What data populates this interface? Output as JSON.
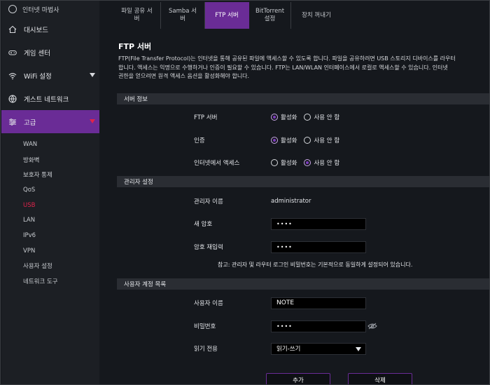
{
  "sidebar": {
    "top_label": "인터넷 마법사",
    "items": [
      {
        "label": "대시보드"
      },
      {
        "label": "게임 센터"
      },
      {
        "label": "WiFi 설정"
      },
      {
        "label": "게스트 네트워크"
      },
      {
        "label": "고급"
      }
    ],
    "sub_items": [
      {
        "label": "WAN"
      },
      {
        "label": "방화벽"
      },
      {
        "label": "보호자 통제"
      },
      {
        "label": "QoS"
      },
      {
        "label": "USB"
      },
      {
        "label": "LAN"
      },
      {
        "label": "IPv6"
      },
      {
        "label": "VPN"
      },
      {
        "label": "사용자 설정"
      },
      {
        "label": "네트워크 도구"
      }
    ]
  },
  "tabs": [
    {
      "label": "파일 공유 서버"
    },
    {
      "label": "Samba 서버"
    },
    {
      "label": "FTP 서버"
    },
    {
      "label": "BitTorrent 설정"
    },
    {
      "label": "장치 꺼내기"
    }
  ],
  "page": {
    "title": "FTP 서버",
    "desc_line1": "FTP(File Transfer Protocol)는 인터넷을 통해 공유된 파일에 액세스할 수 있도록 합니다. 파일을 공유하려면 USB 스토리지 디바이스를 라우터",
    "desc_line2": "합니다. 액세스는 익명으로 수행하거나 인증이 필요할 수 있습니다. FTP는 LAN/WLAN 인터페이스에서 로컬로 액세스할 수 있습니다. 인터넷",
    "desc_line3": "권한을 얻으려면 원격 액세스 옵션을 활성화해야 합니다."
  },
  "server_info": {
    "section_title": "서버 정보",
    "ftp_server_label": "FTP 서버",
    "auth_label": "인증",
    "internet_access_label": "인터넷에서 액세스",
    "enable_label": "활성화",
    "disable_label": "사용 안 함"
  },
  "admin": {
    "section_title": "관리자 설정",
    "username_label": "관리자 이름",
    "username_value": "administrator",
    "new_password_label": "새 암호",
    "new_password_value": "••••",
    "confirm_password_label": "암호 재입력",
    "confirm_password_value": "••••",
    "note": "참고: 관리자 및 라우터 로그인 비밀번호는 기본적으로 동일하게 설정되어 있습니다."
  },
  "users": {
    "section_title": "사용자 계정 목록",
    "username_label": "사용자 이름",
    "username_value": "NOTE",
    "password_label": "비밀번호",
    "password_value": "••••",
    "readonly_label": "읽기 전용",
    "readonly_value": "읽기-쓰기"
  },
  "buttons": {
    "add": "추가",
    "delete": "삭제"
  },
  "colors": {
    "accent": "#6a2c96",
    "active_text": "#e0234b"
  }
}
